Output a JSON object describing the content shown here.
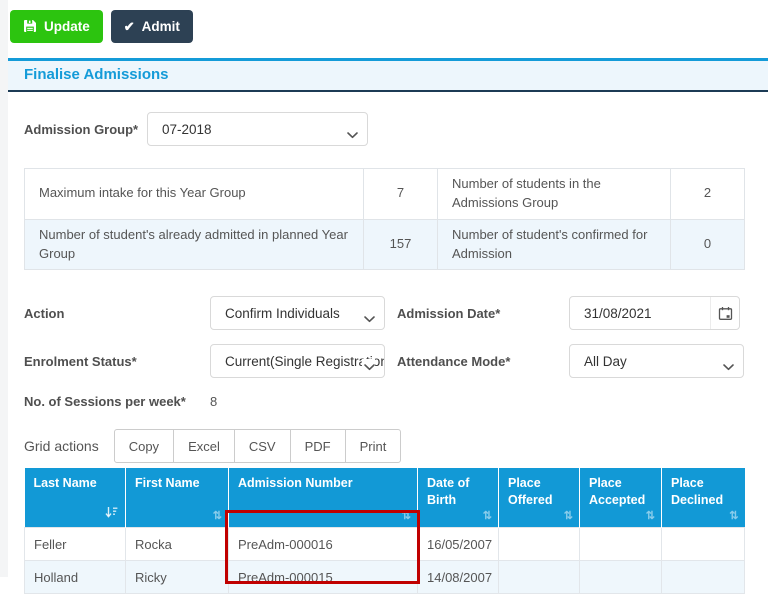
{
  "toolbar": {
    "update_label": "Update",
    "admit_label": "Admit",
    "admit_check_glyph": "✔"
  },
  "panel": {
    "title": "Finalise Admissions"
  },
  "form": {
    "admission_group": {
      "label": "Admission Group*",
      "value": "07-2018"
    },
    "action": {
      "label": "Action",
      "value": "Confirm Individuals"
    },
    "admission_date": {
      "label": "Admission Date*",
      "value": "31/08/2021"
    },
    "enrolment_status": {
      "label": "Enrolment Status*",
      "value": "Current(Single Registration)"
    },
    "attendance_mode": {
      "label": "Attendance Mode*",
      "value": "All Day"
    },
    "sessions_per_week": {
      "label": "No. of Sessions per week*",
      "value": "8"
    }
  },
  "summary": {
    "rows": [
      {
        "label1": "Maximum intake for this Year Group",
        "value1": "7",
        "label2": "Number of students in the Admissions Group",
        "value2": "2"
      },
      {
        "label1": "Number of student's already admitted in planned Year Group",
        "value1": "157",
        "label2": "Number of student's confirmed for Admission",
        "value2": "0"
      }
    ]
  },
  "grid_actions": {
    "label": "Grid actions",
    "buttons": [
      "Copy",
      "Excel",
      "CSV",
      "PDF",
      "Print"
    ]
  },
  "students_table": {
    "columns": [
      "Last Name",
      "First Name",
      "Admission Number",
      "Date of Birth",
      "Place Offered",
      "Place Accepted",
      "Place Declined"
    ],
    "sort_icon_glyph": "⇅",
    "rows": [
      {
        "last_name": "Feller",
        "first_name": "Rocka",
        "admission_number": "PreAdm-000016",
        "date_of_birth": "16/05/2007",
        "place_offered": "",
        "place_accepted": "",
        "place_declined": ""
      },
      {
        "last_name": "Holland",
        "first_name": "Ricky",
        "admission_number": "PreAdm-000015",
        "date_of_birth": "14/08/2007",
        "place_offered": "",
        "place_accepted": "",
        "place_declined": ""
      }
    ]
  },
  "colors": {
    "accent_blue": "#149bd8",
    "table_header_blue": "#1299d6",
    "update_green": "#2cc40f",
    "admit_navy": "#2d4154",
    "highlight_red": "#c00000",
    "row_stripe_blue": "#eef6fc",
    "heading_band_blue": "#edf6fc",
    "heading_underline_navy": "#1c3b55"
  }
}
